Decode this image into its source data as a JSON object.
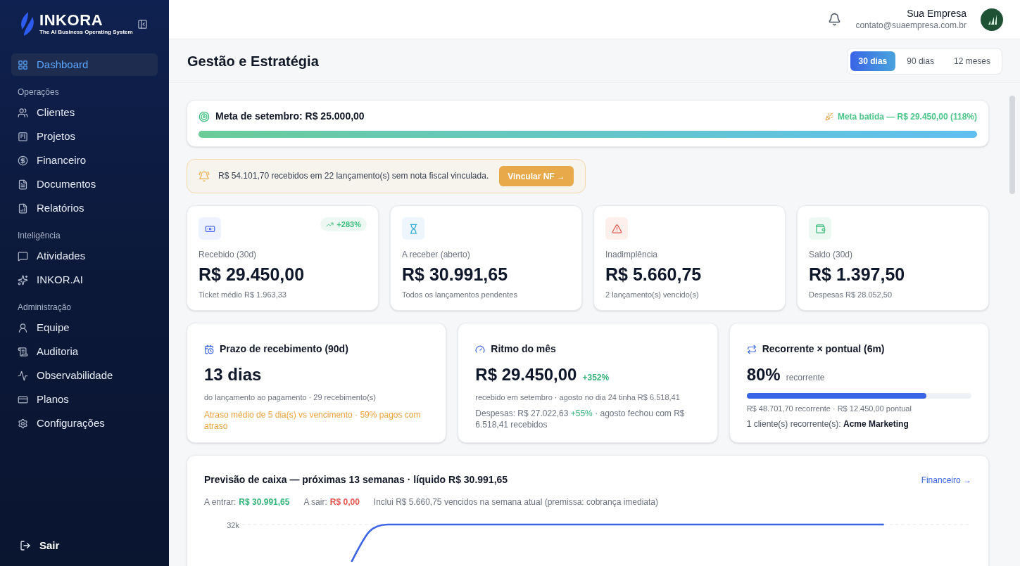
{
  "brand": {
    "name": "INKORA",
    "tagline": "The AI Business Operating System"
  },
  "sidebar": {
    "items": [
      {
        "label": "Dashboard",
        "selected": true
      }
    ],
    "groups": [
      {
        "label": "Operações",
        "items": [
          {
            "label": "Clientes",
            "selected": false
          },
          {
            "label": "Projetos",
            "selected": false
          },
          {
            "label": "Financeiro",
            "selected": false
          },
          {
            "label": "Documentos",
            "selected": false
          },
          {
            "label": "Relatórios",
            "selected": false
          }
        ]
      },
      {
        "label": "Inteligência",
        "items": [
          {
            "label": "Atividades",
            "selected": false
          },
          {
            "label": "INKOR.AI",
            "selected": false
          }
        ]
      },
      {
        "label": "Administração",
        "items": [
          {
            "label": "Equipe",
            "selected": false
          },
          {
            "label": "Auditoria",
            "selected": false
          },
          {
            "label": "Observabilidade",
            "selected": false
          },
          {
            "label": "Planos",
            "selected": false
          },
          {
            "label": "Configurações",
            "selected": false
          }
        ]
      }
    ],
    "logout": "Sair"
  },
  "header": {
    "company": "Sua Empresa",
    "email": "contato@suaempresa.com.br"
  },
  "page_title": "Gestão e Estratégia",
  "periods": [
    {
      "label": "30 dias",
      "selected": true
    },
    {
      "label": "90 dias",
      "selected": false
    },
    {
      "label": "12 meses",
      "selected": false
    }
  ],
  "goal": {
    "title": "Meta de setembro: R$ 25.000,00",
    "status": "Meta batida — R$ 29.450,00 (118%)",
    "level": 1
  },
  "alert": {
    "text": "R$ 54.101,70 recebidos em 22 lançamento(s) sem nota fiscal vinculada.",
    "button": "Vincular NF →"
  },
  "stats": [
    {
      "label": "Recebido (30d)",
      "value": "R$ 29.450,00",
      "sub": "Ticket médio R$ 1.963,33",
      "badge": "+283%"
    },
    {
      "label": "A receber (aberto)",
      "value": "R$ 30.991,65",
      "sub": "Todos os lançamentos pendentes"
    },
    {
      "label": "Inadimplência",
      "value": "R$ 5.660,75",
      "sub": "2 lançamento(s) vencido(s)"
    },
    {
      "label": "Saldo (30d)",
      "value": "R$ 1.397,50",
      "sub": "Despesas R$ 28.052,50"
    }
  ],
  "insights": [
    {
      "title": "Prazo de recebimento (90d)",
      "value": "13 dias",
      "sub": "do lançamento ao pagamento · 29 recebimento(s)",
      "warning": "Atraso médio de 5 dia(s) vs vencimento · 59% pagos com atraso"
    },
    {
      "title": "Ritmo do mês",
      "value": "R$ 29.450,00",
      "badge": "+352%",
      "sub": "recebido em setembro · agosto no dia 24 tinha R$ 6.518,41",
      "line": {
        "prefix": "Despesas: R$ 27.022,63",
        "change": "+55%",
        "suffix": "· agosto fechou com R$ 6.518,41 recebidos"
      }
    },
    {
      "title": "Recorrente × pontual (6m)",
      "value": "80%",
      "suffix": "recorrente",
      "level": 0.8,
      "sub": "R$ 48.701,70 recorrente · R$ 12.450,00 pontual",
      "note": "1 cliente(s) recorrente(s): **Acme Marketing**"
    }
  ],
  "forecast": {
    "title": "Previsão de caixa — próximas 13 semanas · líquido R$ 30.991,65",
    "link": "Financeiro →",
    "summary": [
      {
        "label": "A entrar:",
        "value": "R$ 30.991,65",
        "color": "#34b37a"
      },
      {
        "label": "A sair:",
        "value": "R$ 0,00",
        "color": "#e5534b"
      }
    ],
    "note": "Inclui R$ 5.660,75 vencidos na semana atual (premissa: cobrança imediata)",
    "tick": "32k"
  }
}
